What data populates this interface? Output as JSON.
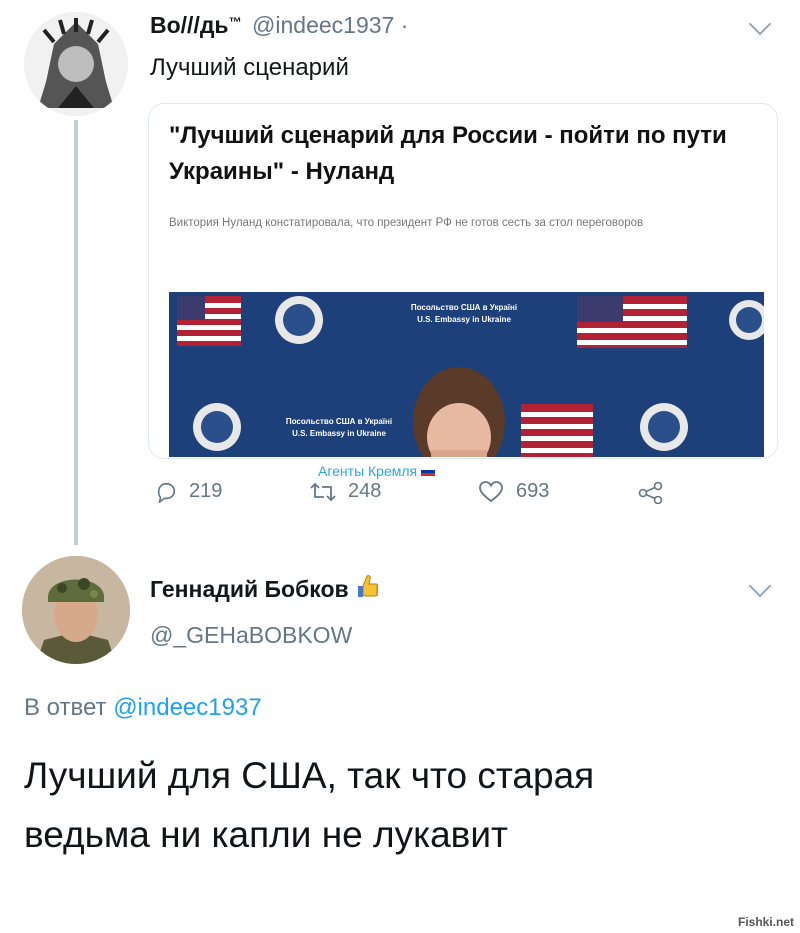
{
  "tweet1": {
    "name": "Bo///дь",
    "tm": "™",
    "handle": "@indeec1937 ·",
    "text": "Лучший сценарий",
    "card": {
      "title": "\"Лучший сценарий для России - пойти по пути Украины\" - Нуланд",
      "description": "Виктория Нуланд констатировала, что президент РФ не готов сесть за стол переговоров",
      "banner_text_1": "Посольство США в Україні",
      "banner_text_2": "U.S. Embassy in Ukraine"
    },
    "watermark": "Агенты Кремля",
    "actions": {
      "replies": "219",
      "retweets": "248",
      "likes": "693"
    }
  },
  "tweet2": {
    "name": "Геннадий Бобков",
    "handle": "@_GEHaBOBKOW",
    "reply_prefix": "В ответ",
    "reply_to": "@indeec1937",
    "text": "Лучший для США, так что старая ведьма ни капли не лукавит"
  },
  "site_watermark": "Fishki.net",
  "colors": {
    "link": "#1da1f2",
    "muted": "#657786",
    "thread_line": "#c4cfd6",
    "flag_blue": "#1d3f7a"
  }
}
